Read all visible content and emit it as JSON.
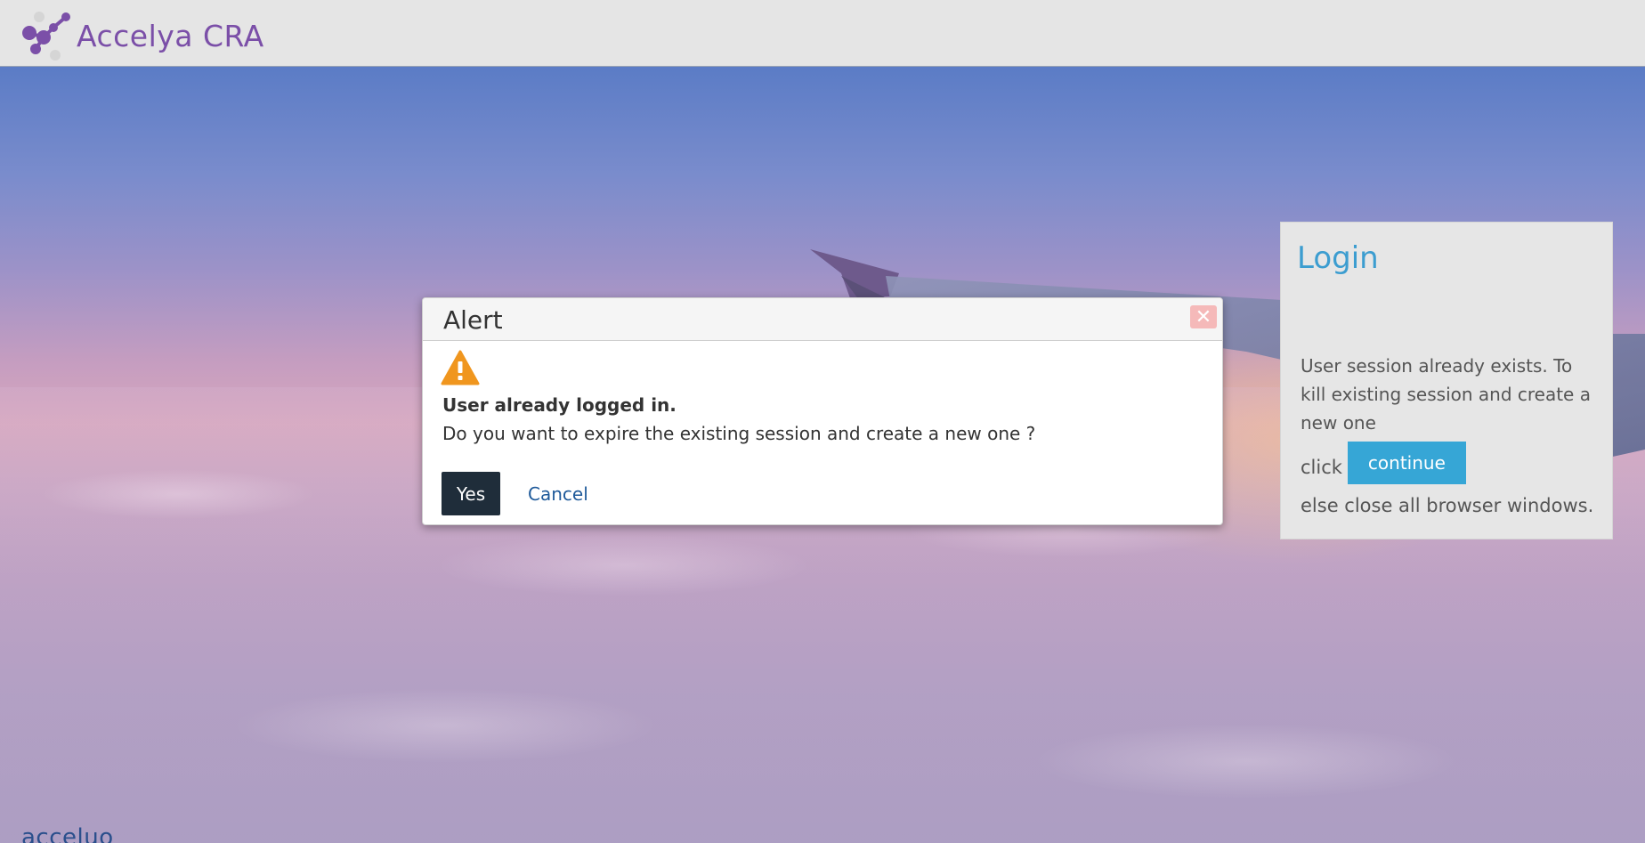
{
  "header": {
    "app_name": "Accelya CRA"
  },
  "footer": {
    "brand_text": "acceluo"
  },
  "login_panel": {
    "title": "Login",
    "message": "User session already exists. To kill existing session and create a new one",
    "click_label": "click",
    "continue_label": "continue",
    "else_text": "else close all browser windows."
  },
  "alert": {
    "title": "Alert",
    "close_symbol": "✕",
    "icon": "warning-icon",
    "heading": "User already logged in.",
    "body": "Do you want to expire the existing session and create a new one ?",
    "yes_label": "Yes",
    "cancel_label": "Cancel"
  },
  "colors": {
    "brand_purple": "#7b4fa8",
    "login_title_blue": "#3c9dd0",
    "continue_button": "#36a6d6",
    "yes_button": "#1f2d3a",
    "cancel_link": "#1f5a9a",
    "warning_orange": "#f0961e",
    "close_button": "#f5b9b9"
  }
}
